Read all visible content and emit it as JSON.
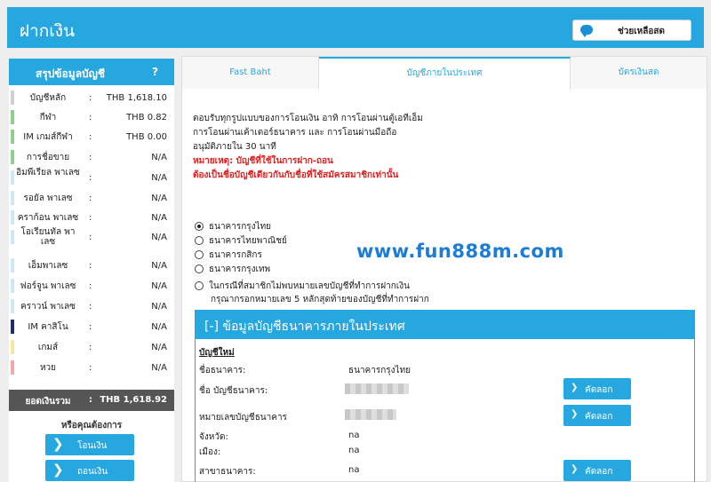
{
  "header": {
    "title": "ฝากเงิน",
    "help_label": "ช่วยเหลือสด",
    "help_icon": "chat-bubble-icon"
  },
  "sidebar": {
    "title": "สรุปข้อมูลบัญชี",
    "help_q": "?",
    "colon": ":",
    "rows": [
      {
        "name": "บัญชีหลัก",
        "value": "THB 1,618.10",
        "color": "#d0d0d0"
      },
      {
        "name": "กีฬา",
        "value": "THB 0.82",
        "color": "#8fd08f"
      },
      {
        "name": "IM เกมส์กีฬา",
        "value": "THB 0.00",
        "color": "#8fd08f"
      },
      {
        "name": "การชื่อขาย",
        "value": "N/A",
        "color": "#8fd08f"
      },
      {
        "name": "อิมพีเรียล พาเลซ",
        "value": "N/A",
        "color": "#cfe6f5"
      },
      {
        "name": "รอยัล พาเลซ",
        "value": "N/A",
        "color": "#cfe6f5"
      },
      {
        "name": "คราก้อน พาเลซ",
        "value": "N/A",
        "color": "#cfe6f5"
      },
      {
        "name": "โอเรียนทัล พาเลซ",
        "value": "N/A",
        "color": "#cfe6f5"
      },
      {
        "name": "เอ็มพาเลซ",
        "value": "N/A",
        "color": "#cfe6f5"
      },
      {
        "name": "ฟอร์จูน พาเลซ",
        "value": "N/A",
        "color": "#cfe6f5"
      },
      {
        "name": "คราวน์ พาเลซ",
        "value": "N/A",
        "color": "#cfe6f5"
      },
      {
        "name": "IM คาสิโน",
        "value": "N/A",
        "color": "#1f2d6b"
      },
      {
        "name": "เกมส์",
        "value": "N/A",
        "color": "#f5e6a0"
      },
      {
        "name": "หวย",
        "value": "N/A",
        "color": "#f2a8a8"
      }
    ],
    "total": {
      "name": "ยอดเงินรวม",
      "value": "THB 1,618.92"
    },
    "subheading": "หรือคุณต้องการ",
    "buttons": [
      "โอนเงิน",
      "ถอนเงิน"
    ]
  },
  "tabs": [
    "Fast Baht",
    "บัญชีภายในประเทศ",
    "บัตรเงินสด"
  ],
  "intro": {
    "lines": [
      "ตอบรับทุกรูปแบบของการโอนเงิน อาทิ การโอนผ่านตู้เอทีเอ็ม",
      "การโอนผ่านเค้าเตอร์ธนาคาร และ การโอนผ่านมือถือ",
      "อนุมัติภายใน 30 นาที"
    ],
    "note_lines": [
      "หมายเหตุ: บัญชีที่ใช้ในการฝาก-ถอน",
      "ต้องเป็นชื่อบัญชีเดียวกันกับชื่อที่ใช้สมัครสมาชิกเท่านั้น"
    ]
  },
  "banks": [
    "ธนาคารกรุงไทย",
    "ธนาคารไทยพาณิชย์",
    "ธนาคารกสิกร",
    "ธนาคารกรุงเทพ",
    "ในกรณีที่สมาชิกไม่พบหมายเลขบัญชีที่ทำการฝากเงิน"
  ],
  "bank_note_line2": "กรุณากรอกหมายเลข 5 หลักสุดท้ายของบัญชีที่ทำการฝาก",
  "watermark": "www.fun888m.com",
  "panel": {
    "title": "[-] ข้อมูลบัญชีธนาคารภายในประเทศ",
    "new_account": "บัญชีใหม่",
    "bank_label": "ชื่อธนาคาร:",
    "bank_value": "ธนาคารกรุงไทย",
    "acct_name_label": "ชื่อ บัญชีธนาคาร:",
    "acct_no_label": "หมายเลขบัญชีธนาคาร",
    "province_label": "จังหวัด:",
    "province_value": "na",
    "city_label": "เมือง:",
    "city_value": "na",
    "branch_label": "สาขาธนาคาร:",
    "branch_value": "na",
    "copy_label": "คัดลอก",
    "chevron": "❯"
  }
}
